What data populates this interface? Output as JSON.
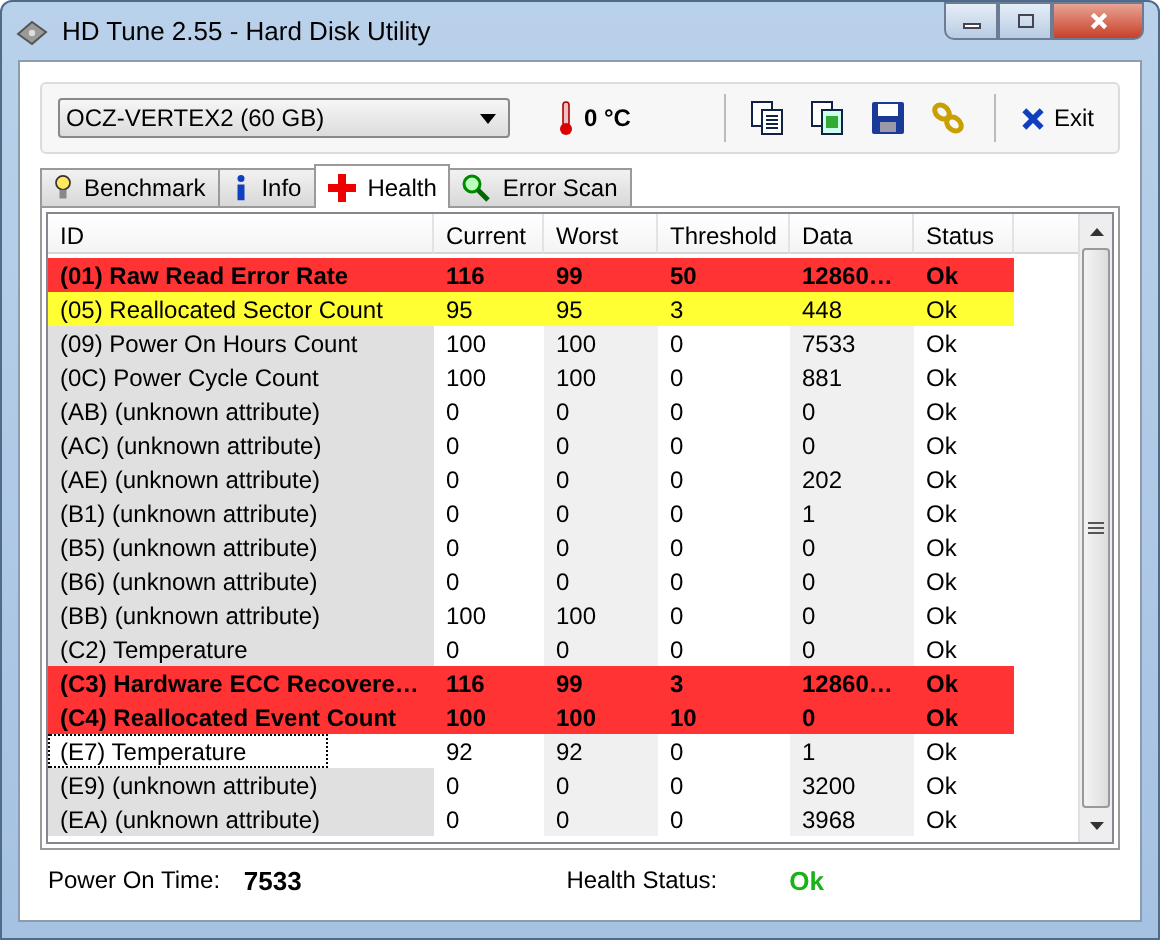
{
  "window": {
    "title": "HD Tune 2.55 - Hard Disk Utility"
  },
  "toolbar": {
    "drive": "OCZ-VERTEX2 (60 GB)",
    "temperature": "0 °C",
    "exit": "Exit"
  },
  "tabs": [
    {
      "label": "Benchmark",
      "selected": false
    },
    {
      "label": "Info",
      "selected": false
    },
    {
      "label": "Health",
      "selected": true
    },
    {
      "label": "Error Scan",
      "selected": false
    }
  ],
  "table": {
    "columns": [
      "ID",
      "Current",
      "Worst",
      "Threshold",
      "Data",
      "Status"
    ],
    "rows": [
      {
        "kind": "critical",
        "focused": false,
        "cells": [
          "(01) Raw Read Error Rate",
          "116",
          "99",
          "50",
          "12860…",
          "Ok"
        ]
      },
      {
        "kind": "warning",
        "focused": false,
        "cells": [
          "(05) Reallocated Sector Count",
          "95",
          "95",
          "3",
          "448",
          "Ok"
        ]
      },
      {
        "kind": "normal",
        "focused": false,
        "cells": [
          "(09) Power On Hours Count",
          "100",
          "100",
          "0",
          "7533",
          "Ok"
        ]
      },
      {
        "kind": "normal",
        "focused": false,
        "cells": [
          "(0C) Power Cycle Count",
          "100",
          "100",
          "0",
          "881",
          "Ok"
        ]
      },
      {
        "kind": "normal",
        "focused": false,
        "cells": [
          "(AB) (unknown attribute)",
          "0",
          "0",
          "0",
          "0",
          "Ok"
        ]
      },
      {
        "kind": "normal",
        "focused": false,
        "cells": [
          "(AC) (unknown attribute)",
          "0",
          "0",
          "0",
          "0",
          "Ok"
        ]
      },
      {
        "kind": "normal",
        "focused": false,
        "cells": [
          "(AE) (unknown attribute)",
          "0",
          "0",
          "0",
          "202",
          "Ok"
        ]
      },
      {
        "kind": "normal",
        "focused": false,
        "cells": [
          "(B1) (unknown attribute)",
          "0",
          "0",
          "0",
          "1",
          "Ok"
        ]
      },
      {
        "kind": "normal",
        "focused": false,
        "cells": [
          "(B5) (unknown attribute)",
          "0",
          "0",
          "0",
          "0",
          "Ok"
        ]
      },
      {
        "kind": "normal",
        "focused": false,
        "cells": [
          "(B6) (unknown attribute)",
          "0",
          "0",
          "0",
          "0",
          "Ok"
        ]
      },
      {
        "kind": "normal",
        "focused": false,
        "cells": [
          "(BB) (unknown attribute)",
          "100",
          "100",
          "0",
          "0",
          "Ok"
        ]
      },
      {
        "kind": "normal",
        "focused": false,
        "cells": [
          "(C2) Temperature",
          "0",
          "0",
          "0",
          "0",
          "Ok"
        ]
      },
      {
        "kind": "critical",
        "focused": false,
        "cells": [
          "(C3) Hardware ECC Recovere…",
          "116",
          "99",
          "3",
          "12860…",
          "Ok"
        ]
      },
      {
        "kind": "critical",
        "focused": false,
        "cells": [
          "(C4) Reallocated Event Count",
          "100",
          "100",
          "10",
          "0",
          "Ok"
        ]
      },
      {
        "kind": "normal",
        "focused": true,
        "cells": [
          "(E7) Temperature",
          "92",
          "92",
          "0",
          "1",
          "Ok"
        ]
      },
      {
        "kind": "normal",
        "focused": false,
        "cells": [
          "(E9) (unknown attribute)",
          "0",
          "0",
          "0",
          "3200",
          "Ok"
        ]
      },
      {
        "kind": "normal",
        "focused": false,
        "cells": [
          "(EA) (unknown attribute)",
          "0",
          "0",
          "0",
          "3968",
          "Ok"
        ]
      }
    ]
  },
  "footer": {
    "power_on_label": "Power On Time:",
    "power_on_value": "7533",
    "health_label": "Health Status:",
    "health_value": "Ok"
  }
}
